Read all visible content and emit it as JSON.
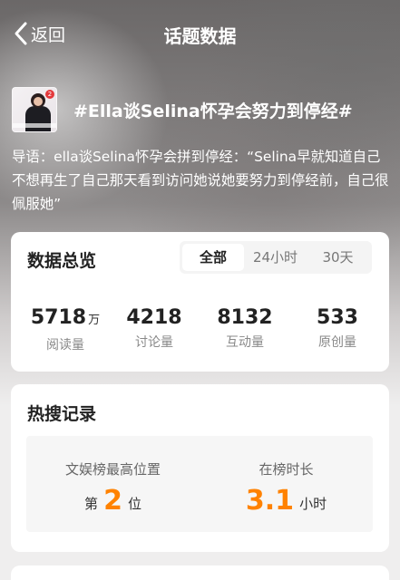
{
  "nav": {
    "back_label": "返回",
    "title": "话题数据"
  },
  "topic": {
    "title": "#Ella谈Selina怀孕会努力到停经#",
    "intro": "导语：ella谈Selina怀孕会拼到停经：“Selina早就知道自己不想再生了自己那天看到访问她说她要努力到停经前，自己很佩服她”"
  },
  "overview": {
    "title": "数据总览",
    "tabs": [
      "全部",
      "24小时",
      "30天"
    ],
    "active_tab": "全部",
    "stats": [
      {
        "value": "5718",
        "unit": "万",
        "label": "阅读量"
      },
      {
        "value": "4218",
        "unit": "",
        "label": "讨论量"
      },
      {
        "value": "8132",
        "unit": "",
        "label": "互动量"
      },
      {
        "value": "533",
        "unit": "",
        "label": "原创量"
      }
    ]
  },
  "hot_search": {
    "title": "热搜记录",
    "highest_label": "文娱榜最高位置",
    "highest_prefix": "第",
    "highest_value": "2",
    "highest_suffix": "位",
    "duration_label": "在榜时长",
    "duration_value": "3.1",
    "duration_unit": "小时"
  },
  "colors": {
    "accent": "#ff8200"
  }
}
